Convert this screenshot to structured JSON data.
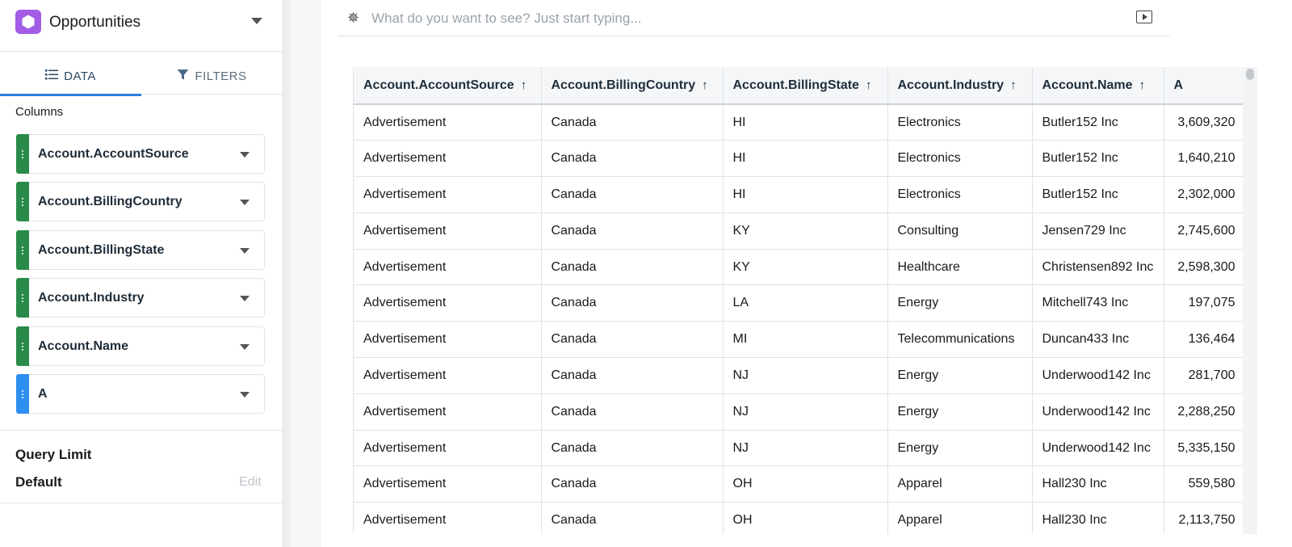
{
  "datasource": {
    "title": "Opportunities",
    "icon": "hexagon-icon",
    "accent": "#a25ce6"
  },
  "tabs": [
    {
      "label": "DATA",
      "icon": "list-icon",
      "active": true
    },
    {
      "label": "FILTERS",
      "icon": "filter-icon",
      "active": false
    }
  ],
  "columns_section": {
    "label": "Columns",
    "items": [
      {
        "label": "Account.AccountSource",
        "color": "#2a8a4a"
      },
      {
        "label": "Account.BillingCountry",
        "color": "#2a8a4a"
      },
      {
        "label": "Account.BillingState",
        "color": "#2a8a4a"
      },
      {
        "label": "Account.Industry",
        "color": "#2a8a4a"
      },
      {
        "label": "Account.Name",
        "color": "#2a8a4a"
      },
      {
        "label": "A",
        "color": "#2d8ff0"
      }
    ]
  },
  "query_limit": {
    "title": "Query Limit",
    "value": "Default",
    "edit_label": "Edit"
  },
  "search": {
    "placeholder": "What do you want to see? Just start typing..."
  },
  "table": {
    "headers": [
      {
        "label": "Account.AccountSource",
        "sort": "↑"
      },
      {
        "label": "Account.BillingCountry",
        "sort": "↑"
      },
      {
        "label": "Account.BillingState",
        "sort": "↑"
      },
      {
        "label": "Account.Industry",
        "sort": "↑"
      },
      {
        "label": "Account.Name",
        "sort": "↑"
      },
      {
        "label": "A",
        "sort": ""
      }
    ],
    "rows": [
      [
        "Advertisement",
        "Canada",
        "HI",
        "Electronics",
        "Butler152 Inc",
        "3,609,320"
      ],
      [
        "Advertisement",
        "Canada",
        "HI",
        "Electronics",
        "Butler152 Inc",
        "1,640,210"
      ],
      [
        "Advertisement",
        "Canada",
        "HI",
        "Electronics",
        "Butler152 Inc",
        "2,302,000"
      ],
      [
        "Advertisement",
        "Canada",
        "KY",
        "Consulting",
        "Jensen729 Inc",
        "2,745,600"
      ],
      [
        "Advertisement",
        "Canada",
        "KY",
        "Healthcare",
        "Christensen892 Inc",
        "2,598,300"
      ],
      [
        "Advertisement",
        "Canada",
        "LA",
        "Energy",
        "Mitchell743 Inc",
        "197,075"
      ],
      [
        "Advertisement",
        "Canada",
        "MI",
        "Telecommunications",
        "Duncan433 Inc",
        "136,464"
      ],
      [
        "Advertisement",
        "Canada",
        "NJ",
        "Energy",
        "Underwood142 Inc",
        "281,700"
      ],
      [
        "Advertisement",
        "Canada",
        "NJ",
        "Energy",
        "Underwood142 Inc",
        "2,288,250"
      ],
      [
        "Advertisement",
        "Canada",
        "NJ",
        "Energy",
        "Underwood142 Inc",
        "5,335,150"
      ],
      [
        "Advertisement",
        "Canada",
        "OH",
        "Apparel",
        "Hall230 Inc",
        "559,580"
      ],
      [
        "Advertisement",
        "Canada",
        "OH",
        "Apparel",
        "Hall230 Inc",
        "2,113,750"
      ]
    ]
  }
}
